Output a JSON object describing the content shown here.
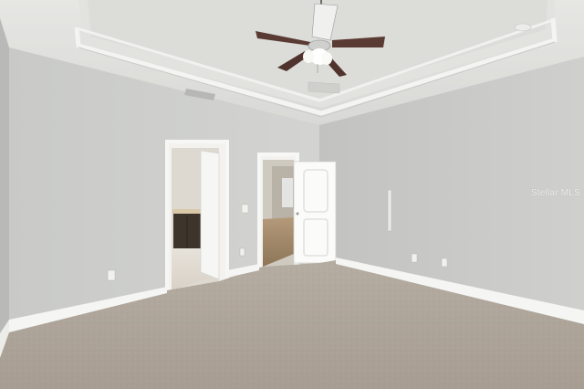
{
  "photo": {
    "watermark": "Stellar MLS"
  }
}
